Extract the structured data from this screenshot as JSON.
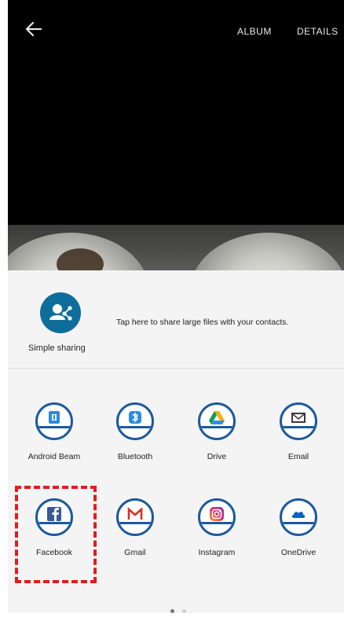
{
  "header": {
    "album_label": "ALBUM",
    "details_label": "DETAILS"
  },
  "simple_sharing": {
    "label": "Simple sharing",
    "hint": "Tap here to share large files with your contacts."
  },
  "apps": [
    {
      "label": "Android Beam",
      "icon": "android-beam-icon"
    },
    {
      "label": "Bluetooth",
      "icon": "bluetooth-icon"
    },
    {
      "label": "Drive",
      "icon": "drive-icon"
    },
    {
      "label": "Email",
      "icon": "email-icon"
    },
    {
      "label": "Facebook",
      "icon": "facebook-icon"
    },
    {
      "label": "Gmail",
      "icon": "gmail-icon"
    },
    {
      "label": "Instagram",
      "icon": "instagram-icon"
    },
    {
      "label": "OneDrive",
      "icon": "onedrive-icon"
    }
  ],
  "colors": {
    "highlight": "#e31b1b",
    "icon_ring": "#1b5a9c"
  },
  "pager": {
    "pages": 2,
    "current": 1
  }
}
